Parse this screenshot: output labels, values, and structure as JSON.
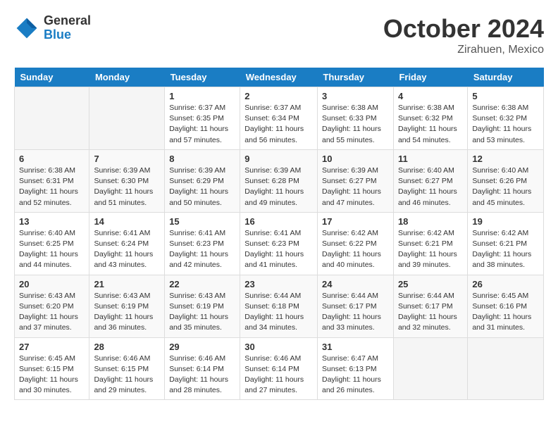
{
  "header": {
    "logo_line1": "General",
    "logo_line2": "Blue",
    "month": "October 2024",
    "location": "Zirahuen, Mexico"
  },
  "days_of_week": [
    "Sunday",
    "Monday",
    "Tuesday",
    "Wednesday",
    "Thursday",
    "Friday",
    "Saturday"
  ],
  "weeks": [
    [
      {
        "day": "",
        "info": ""
      },
      {
        "day": "",
        "info": ""
      },
      {
        "day": "1",
        "info": "Sunrise: 6:37 AM\nSunset: 6:35 PM\nDaylight: 11 hours and 57 minutes."
      },
      {
        "day": "2",
        "info": "Sunrise: 6:37 AM\nSunset: 6:34 PM\nDaylight: 11 hours and 56 minutes."
      },
      {
        "day": "3",
        "info": "Sunrise: 6:38 AM\nSunset: 6:33 PM\nDaylight: 11 hours and 55 minutes."
      },
      {
        "day": "4",
        "info": "Sunrise: 6:38 AM\nSunset: 6:32 PM\nDaylight: 11 hours and 54 minutes."
      },
      {
        "day": "5",
        "info": "Sunrise: 6:38 AM\nSunset: 6:32 PM\nDaylight: 11 hours and 53 minutes."
      }
    ],
    [
      {
        "day": "6",
        "info": "Sunrise: 6:38 AM\nSunset: 6:31 PM\nDaylight: 11 hours and 52 minutes."
      },
      {
        "day": "7",
        "info": "Sunrise: 6:39 AM\nSunset: 6:30 PM\nDaylight: 11 hours and 51 minutes."
      },
      {
        "day": "8",
        "info": "Sunrise: 6:39 AM\nSunset: 6:29 PM\nDaylight: 11 hours and 50 minutes."
      },
      {
        "day": "9",
        "info": "Sunrise: 6:39 AM\nSunset: 6:28 PM\nDaylight: 11 hours and 49 minutes."
      },
      {
        "day": "10",
        "info": "Sunrise: 6:39 AM\nSunset: 6:27 PM\nDaylight: 11 hours and 47 minutes."
      },
      {
        "day": "11",
        "info": "Sunrise: 6:40 AM\nSunset: 6:27 PM\nDaylight: 11 hours and 46 minutes."
      },
      {
        "day": "12",
        "info": "Sunrise: 6:40 AM\nSunset: 6:26 PM\nDaylight: 11 hours and 45 minutes."
      }
    ],
    [
      {
        "day": "13",
        "info": "Sunrise: 6:40 AM\nSunset: 6:25 PM\nDaylight: 11 hours and 44 minutes."
      },
      {
        "day": "14",
        "info": "Sunrise: 6:41 AM\nSunset: 6:24 PM\nDaylight: 11 hours and 43 minutes."
      },
      {
        "day": "15",
        "info": "Sunrise: 6:41 AM\nSunset: 6:23 PM\nDaylight: 11 hours and 42 minutes."
      },
      {
        "day": "16",
        "info": "Sunrise: 6:41 AM\nSunset: 6:23 PM\nDaylight: 11 hours and 41 minutes."
      },
      {
        "day": "17",
        "info": "Sunrise: 6:42 AM\nSunset: 6:22 PM\nDaylight: 11 hours and 40 minutes."
      },
      {
        "day": "18",
        "info": "Sunrise: 6:42 AM\nSunset: 6:21 PM\nDaylight: 11 hours and 39 minutes."
      },
      {
        "day": "19",
        "info": "Sunrise: 6:42 AM\nSunset: 6:21 PM\nDaylight: 11 hours and 38 minutes."
      }
    ],
    [
      {
        "day": "20",
        "info": "Sunrise: 6:43 AM\nSunset: 6:20 PM\nDaylight: 11 hours and 37 minutes."
      },
      {
        "day": "21",
        "info": "Sunrise: 6:43 AM\nSunset: 6:19 PM\nDaylight: 11 hours and 36 minutes."
      },
      {
        "day": "22",
        "info": "Sunrise: 6:43 AM\nSunset: 6:19 PM\nDaylight: 11 hours and 35 minutes."
      },
      {
        "day": "23",
        "info": "Sunrise: 6:44 AM\nSunset: 6:18 PM\nDaylight: 11 hours and 34 minutes."
      },
      {
        "day": "24",
        "info": "Sunrise: 6:44 AM\nSunset: 6:17 PM\nDaylight: 11 hours and 33 minutes."
      },
      {
        "day": "25",
        "info": "Sunrise: 6:44 AM\nSunset: 6:17 PM\nDaylight: 11 hours and 32 minutes."
      },
      {
        "day": "26",
        "info": "Sunrise: 6:45 AM\nSunset: 6:16 PM\nDaylight: 11 hours and 31 minutes."
      }
    ],
    [
      {
        "day": "27",
        "info": "Sunrise: 6:45 AM\nSunset: 6:15 PM\nDaylight: 11 hours and 30 minutes."
      },
      {
        "day": "28",
        "info": "Sunrise: 6:46 AM\nSunset: 6:15 PM\nDaylight: 11 hours and 29 minutes."
      },
      {
        "day": "29",
        "info": "Sunrise: 6:46 AM\nSunset: 6:14 PM\nDaylight: 11 hours and 28 minutes."
      },
      {
        "day": "30",
        "info": "Sunrise: 6:46 AM\nSunset: 6:14 PM\nDaylight: 11 hours and 27 minutes."
      },
      {
        "day": "31",
        "info": "Sunrise: 6:47 AM\nSunset: 6:13 PM\nDaylight: 11 hours and 26 minutes."
      },
      {
        "day": "",
        "info": ""
      },
      {
        "day": "",
        "info": ""
      }
    ]
  ]
}
